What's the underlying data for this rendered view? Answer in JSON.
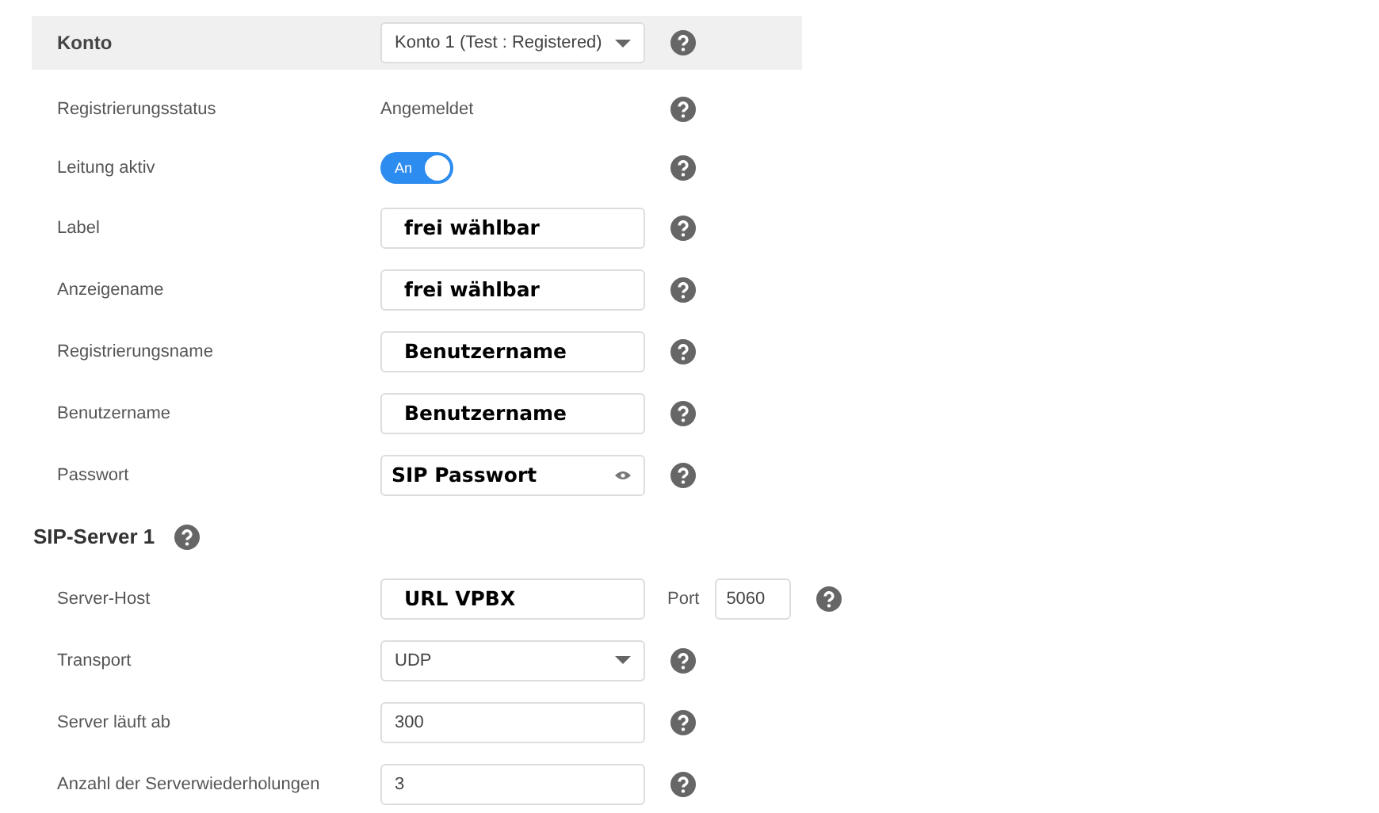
{
  "rows": [
    {
      "kind": "account",
      "label": "Konto",
      "value": "Konto 1 (Test : Registered)"
    },
    {
      "kind": "text",
      "label": "Registrierungsstatus",
      "value": "Angemeldet"
    },
    {
      "kind": "toggle",
      "label": "Leitung aktiv",
      "on": true,
      "value": "An"
    },
    {
      "kind": "input",
      "label": "Label",
      "value": "frei wählbar",
      "bold": true
    },
    {
      "kind": "input",
      "label": "Anzeigename",
      "value": "frei wählbar",
      "bold": true
    },
    {
      "kind": "input",
      "label": "Registrierungsname",
      "value": "Benutzername",
      "bold": true
    },
    {
      "kind": "input",
      "label": "Benutzername",
      "value": "Benutzername",
      "bold": true
    },
    {
      "kind": "password",
      "label": "Passwort",
      "value": "SIP Passwort",
      "bold": true
    },
    {
      "kind": "heading",
      "label": "SIP-Server 1"
    },
    {
      "kind": "host",
      "label": "Server-Host",
      "value": "URL VPBX",
      "bold": true,
      "port_label": "Port",
      "port": "5060"
    },
    {
      "kind": "select",
      "label": "Transport",
      "value": "UDP"
    },
    {
      "kind": "input",
      "label": "Server läuft ab",
      "value": "300",
      "bold": false
    },
    {
      "kind": "input",
      "label": "Anzahl der Serverwiederholungen",
      "value": "3",
      "bold": false
    }
  ]
}
